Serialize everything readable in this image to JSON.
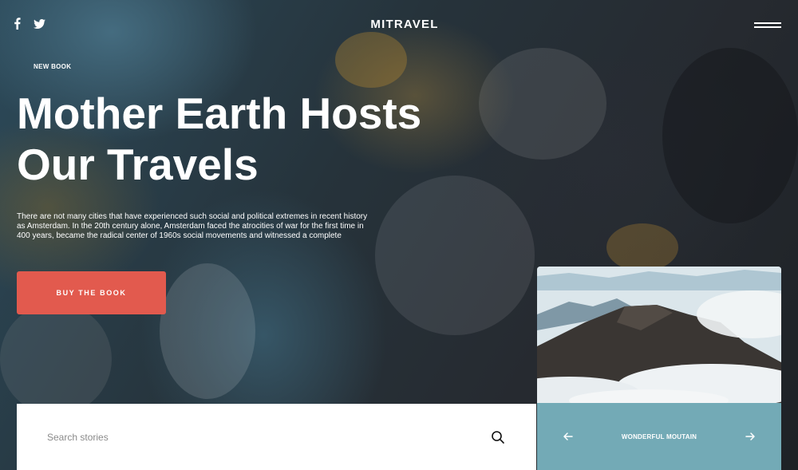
{
  "header": {
    "brand": "MITRAVEL",
    "social": [
      {
        "name": "facebook-icon"
      },
      {
        "name": "twitter-icon"
      }
    ],
    "menu_icon": "hamburger-menu-icon"
  },
  "hero": {
    "tag": "NEW BOOK",
    "headline_line1": "Mother Earth Hosts",
    "headline_line2": "Our Travels",
    "description": "There are not many cities that have experienced such social and political extremes in recent history as Amsterdam. In the 20th century alone, Amsterdam faced the atrocities of war for the first time in 400 years, became the radical center of 1960s social movements and witnessed a complete",
    "cta_label": "BUY THE BOOK",
    "cta_color": "#e25a4e"
  },
  "search": {
    "placeholder": "Search stories",
    "value": "",
    "icon": "search-icon"
  },
  "feature_card": {
    "title": "WONDERFUL MOUTAIN",
    "nav_color": "#73aab6",
    "prev_icon": "arrow-left-icon",
    "next_icon": "arrow-right-icon"
  }
}
